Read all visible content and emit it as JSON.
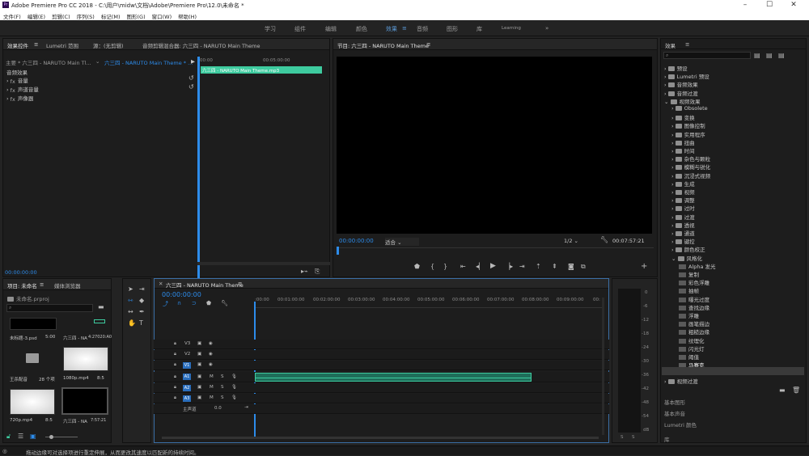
{
  "window": {
    "title": "Adobe Premiere Pro CC 2018 - C:\\用户\\midw\\文档\\Adobe\\Premiere Pro\\12.0\\未命名 *",
    "logo": "Pr"
  },
  "menu": [
    "文件(F)",
    "编辑(E)",
    "剪辑(C)",
    "序列(S)",
    "标记(M)",
    "图形(G)",
    "窗口(W)",
    "帮助(H)"
  ],
  "workspaces": [
    "学习",
    "组件",
    "编辑",
    "颜色",
    "效果",
    "音频",
    "图形",
    "库",
    "Learning"
  ],
  "effect_controls": {
    "tabs": [
      "效果控件",
      "Lumetri 范围",
      "源：(无剪辑)",
      "音频剪辑混合器: 六三四 - NARUTO Main Theme"
    ],
    "clip_path": "主要 * 六三四 - NARUTO Main Tl...",
    "sequence_path": "六三四 - NARUTO Main Theme * ...",
    "tc_start": "00:00",
    "tc_end": "00:05:00:00",
    "clip_bar": "六三四 - NARUTO Main Theme.mp3",
    "section": "音频效果",
    "rows": [
      "音量",
      "声道音量",
      "声像器"
    ],
    "timecode": "00:00:00:00"
  },
  "program": {
    "tab": "节目: 六三四 - NARUTO Main Theme",
    "timecode": "00:00:00:00",
    "fit": "适合",
    "quality": "1/2",
    "duration": "00:07:57:21"
  },
  "project": {
    "tabs": [
      "项目: 未命名",
      "媒体浏览器"
    ],
    "name": "未命名.prproj",
    "items": [
      {
        "name": "未标题-3.psd",
        "meta": "5:00"
      },
      {
        "name": "六三四 - NARUTO...",
        "meta": "4:27020:A0"
      },
      {
        "name": "王杀配音",
        "meta": "28 个项"
      },
      {
        "name": "1080p.mp4",
        "meta": "8:5"
      },
      {
        "name": "720p.mp4",
        "meta": "8:5"
      },
      {
        "name": "六三四 - NA...",
        "meta": "7:57:21"
      }
    ]
  },
  "timeline": {
    "tab": "六三四 - NARUTO Main Theme",
    "timecode": "00:00:00:00",
    "ticks": [
      ":00:00",
      "00:01:00:00",
      "00:02:00:00",
      "00:03:00:00",
      "00:04:00:00",
      "00:05:00:00",
      "00:06:00:00",
      "00:07:00:00",
      "00:08:00:00",
      "00:09:00:00",
      "00:"
    ],
    "video_tracks": [
      "V3",
      "V2",
      "V1"
    ],
    "audio_tracks": [
      "A1",
      "A2",
      "A3"
    ],
    "master": "主声道",
    "master_value": "0.0",
    "track_btn_m": "M",
    "track_btn_s": "S"
  },
  "meters": {
    "labels": [
      "0",
      "-6",
      "-12",
      "-18",
      "-24",
      "-30",
      "-36",
      "-42",
      "-48",
      "-54",
      "dB"
    ],
    "solo_s": "S",
    "solo_m": "S"
  },
  "effects": {
    "title": "效果",
    "items": [
      {
        "label": "预设",
        "level": 0
      },
      {
        "label": "Lumetri 预设",
        "level": 0
      },
      {
        "label": "音频效果",
        "level": 0
      },
      {
        "label": "音频过渡",
        "level": 0
      },
      {
        "label": "视频效果",
        "level": 0,
        "open": true
      },
      {
        "label": "Obsolete",
        "level": 1
      },
      {
        "label": "变换",
        "level": 1
      },
      {
        "label": "图像控制",
        "level": 1
      },
      {
        "label": "实用程序",
        "level": 1
      },
      {
        "label": "扭曲",
        "level": 1
      },
      {
        "label": "时间",
        "level": 1
      },
      {
        "label": "杂色与颗粒",
        "level": 1
      },
      {
        "label": "模糊与锐化",
        "level": 1
      },
      {
        "label": "沉浸式视频",
        "level": 1
      },
      {
        "label": "生成",
        "level": 1
      },
      {
        "label": "视频",
        "level": 1
      },
      {
        "label": "调整",
        "level": 1
      },
      {
        "label": "过时",
        "level": 1
      },
      {
        "label": "过渡",
        "level": 1
      },
      {
        "label": "透视",
        "level": 1
      },
      {
        "label": "通道",
        "level": 1
      },
      {
        "label": "键控",
        "level": 1
      },
      {
        "label": "颜色校正",
        "level": 1
      },
      {
        "label": "风格化",
        "level": 1,
        "open": true
      },
      {
        "label": "Alpha 发光",
        "level": 2
      },
      {
        "label": "复制",
        "level": 2
      },
      {
        "label": "彩色浮雕",
        "level": 2
      },
      {
        "label": "抽帧",
        "level": 2
      },
      {
        "label": "曝光过度",
        "level": 2
      },
      {
        "label": "查找边缘",
        "level": 2
      },
      {
        "label": "浮雕",
        "level": 2
      },
      {
        "label": "画笔描边",
        "level": 2
      },
      {
        "label": "粗糙边缘",
        "level": 2
      },
      {
        "label": "纹理化",
        "level": 2
      },
      {
        "label": "闪光灯",
        "level": 2
      },
      {
        "label": "阈值",
        "level": 2
      },
      {
        "label": "马赛克",
        "level": 2,
        "selected": true
      }
    ],
    "lower": [
      "视频过渡",
      "基本图形",
      "基本声音",
      "Lumetri 颜色",
      "库"
    ]
  },
  "status": "拖动边缘可对选择项进行重定伸展，从而更改其速度以匹配新的持续时间。",
  "colors": {
    "accent": "#2d8ceb",
    "clip": "#3ecb9f",
    "audio": "#1f6e5a"
  }
}
